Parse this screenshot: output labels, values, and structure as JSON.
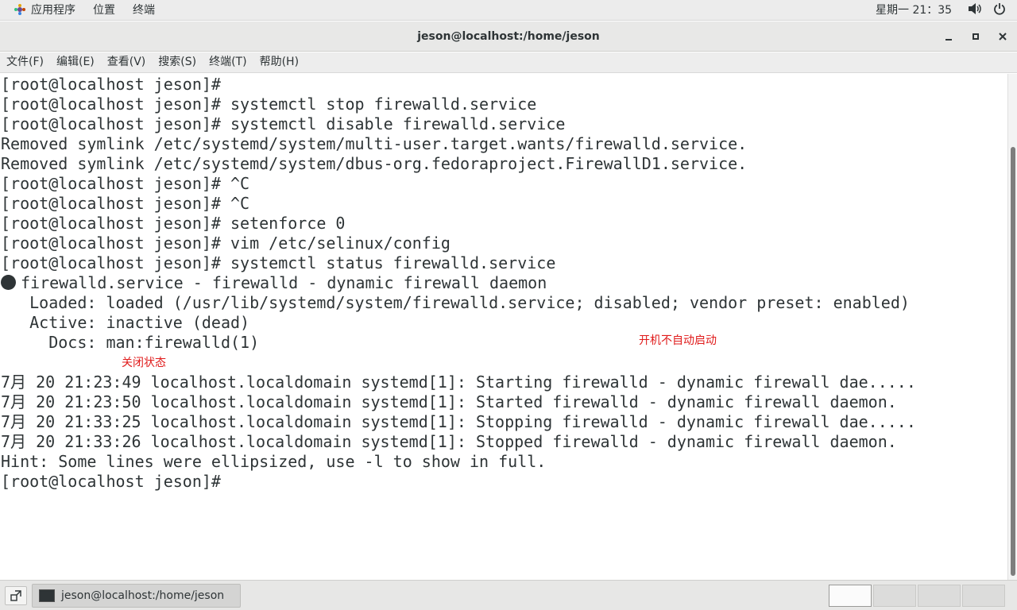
{
  "top_panel": {
    "applications": "应用程序",
    "places": "位置",
    "terminal": "终端",
    "clock": "星期一 21：35",
    "volume_icon": "volume-icon",
    "power_icon": "power-icon"
  },
  "window": {
    "title": "jeson@localhost:/home/jeson"
  },
  "menubar": {
    "file": "文件(F)",
    "edit": "编辑(E)",
    "view": "查看(V)",
    "search": "搜索(S)",
    "terminal": "终端(T)",
    "help": "帮助(H)"
  },
  "terminal": {
    "lines": [
      "[root@localhost jeson]#",
      "[root@localhost jeson]# systemctl stop firewalld.service",
      "[root@localhost jeson]# systemctl disable firewalld.service",
      "Removed symlink /etc/systemd/system/multi-user.target.wants/firewalld.service.",
      "Removed symlink /etc/systemd/system/dbus-org.fedoraproject.FirewallD1.service.",
      "[root@localhost jeson]# ^C",
      "[root@localhost jeson]# ^C",
      "[root@localhost jeson]# setenforce 0",
      "[root@localhost jeson]# vim /etc/selinux/config",
      "[root@localhost jeson]# systemctl status firewalld.service",
      "firewalld.service - firewalld - dynamic firewall daemon",
      "   Loaded: loaded (/usr/lib/systemd/system/firewalld.service; disabled; vendor preset: enabled)",
      "   Active: inactive (dead)",
      "     Docs: man:firewalld(1)",
      "",
      "7月 20 21:23:49 localhost.localdomain systemd[1]: Starting firewalld - dynamic firewall dae.....",
      "7月 20 21:23:50 localhost.localdomain systemd[1]: Started firewalld - dynamic firewall daemon.",
      "7月 20 21:33:25 localhost.localdomain systemd[1]: Stopping firewalld - dynamic firewall dae.....",
      "7月 20 21:33:26 localhost.localdomain systemd[1]: Stopped firewalld - dynamic firewall daemon.",
      "Hint: Some lines were ellipsized, use -l to show in full.",
      "[root@localhost jeson]#"
    ],
    "annotation_boot": "开机不自动启动",
    "annotation_status": "关闭状态",
    "accent_red": "#e01b1b"
  },
  "taskbar": {
    "task_label": "jeson@localhost:/home/jeson"
  }
}
